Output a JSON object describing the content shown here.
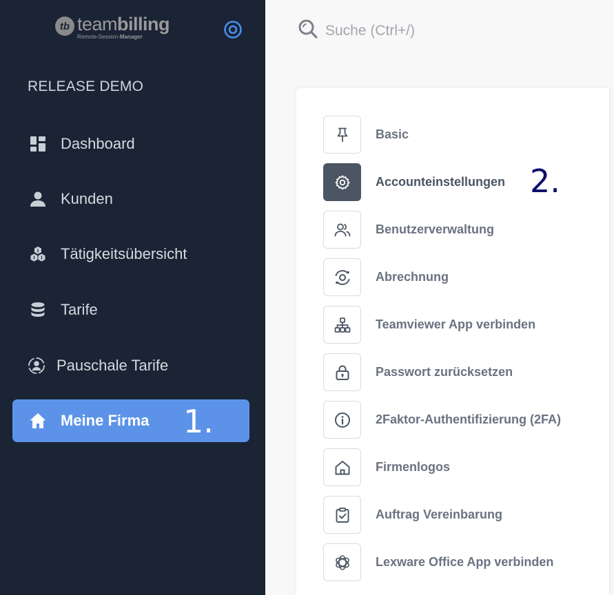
{
  "brand": {
    "mark": "tb",
    "name_light": "team",
    "name_bold": "billing",
    "tagline_light": "Remote-Session-",
    "tagline_bold": "Manager"
  },
  "company_name": "RELEASE DEMO",
  "nav": [
    {
      "label": "Dashboard",
      "icon": "dashboard-icon"
    },
    {
      "label": "Kunden",
      "icon": "user-icon"
    },
    {
      "label": "Tätigkeitsübersicht",
      "icon": "cubes-icon"
    },
    {
      "label": "Tarife",
      "icon": "database-icon"
    },
    {
      "label": "Pauschale Tarife",
      "icon": "user-circle-icon"
    },
    {
      "label": "Meine Firma",
      "icon": "home-icon",
      "active": true
    }
  ],
  "annotations": {
    "step1": "1.",
    "step2": "2."
  },
  "search": {
    "placeholder": "Suche (Ctrl+/)"
  },
  "settings": [
    {
      "label": "Basic",
      "icon": "pin-icon"
    },
    {
      "label": "Accounteinstellungen",
      "icon": "gear-icon",
      "active": true
    },
    {
      "label": "Benutzerverwaltung",
      "icon": "users-icon"
    },
    {
      "label": "Abrechnung",
      "icon": "billing-cycle-icon"
    },
    {
      "label": "Teamviewer App verbinden",
      "icon": "sitemap-icon"
    },
    {
      "label": "Passwort zurücksetzen",
      "icon": "lock-icon"
    },
    {
      "label": "2Faktor-Authentifizierung (2FA)",
      "icon": "info-icon"
    },
    {
      "label": "Firmenlogos",
      "icon": "house-icon"
    },
    {
      "label": "Auftrag Vereinbarung",
      "icon": "clipboard-check-icon"
    },
    {
      "label": "Lexware Office App verbinden",
      "icon": "link-rings-icon"
    }
  ],
  "colors": {
    "sidebar_bg": "#1a2435",
    "active_nav": "#5c93e9",
    "accent": "#4a8ef0",
    "active_setting": "#4b5563",
    "annotation": "#0d0d6b"
  }
}
